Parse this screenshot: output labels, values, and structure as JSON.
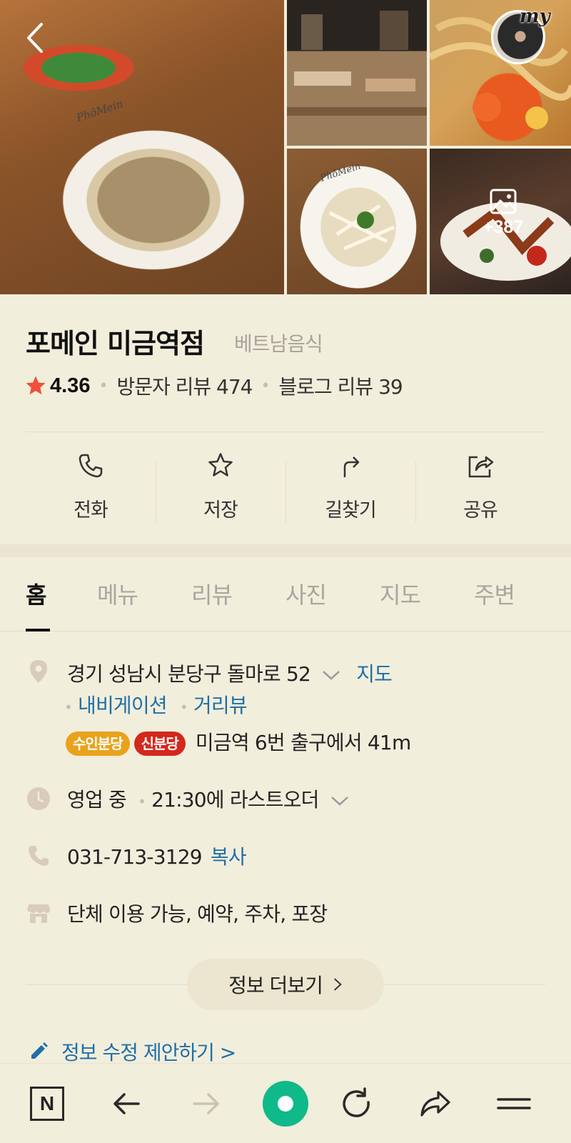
{
  "gallery": {
    "more_count": "+387",
    "my_label": "my",
    "logo_text_main": "PhôMein",
    "logo_text_small": "PhôMein"
  },
  "place": {
    "name": "포메인 미금역점",
    "category": "베트남음식",
    "rating": "4.36",
    "visitor_reviews": "방문자 리뷰 474",
    "blog_reviews": "블로그 리뷰 39"
  },
  "actions": {
    "call": "전화",
    "save": "저장",
    "directions": "길찾기",
    "share": "공유"
  },
  "tabs": [
    "홈",
    "메뉴",
    "리뷰",
    "사진",
    "지도",
    "주변"
  ],
  "details": {
    "address": "경기 성남시 분당구 돌마로 52",
    "map_link": "지도",
    "navigation_link": "내비게이션",
    "streetview_link": "거리뷰",
    "line_badge_1": "수인분당",
    "line_badge_2": "신분당",
    "station_info": "미금역 6번 출구에서 41m",
    "hours_status": "영업 중",
    "hours_detail": "21:30에 라스트오더",
    "phone": "031-713-3129",
    "copy_link": "복사",
    "amenities": "단체 이용 가능, 예약, 주차, 포장",
    "more_info": "정보 더보기",
    "edit_suggest": "정보 수정 제안하기 >"
  },
  "bottom_bar": {
    "n_logo": "N"
  },
  "colors": {
    "background": "#f2eedc",
    "link": "#1f6fa8",
    "star": "#f0503c",
    "suin_bundang": "#e9a21c",
    "sin_bundang": "#d4281c",
    "home_button": "#10b98a"
  }
}
